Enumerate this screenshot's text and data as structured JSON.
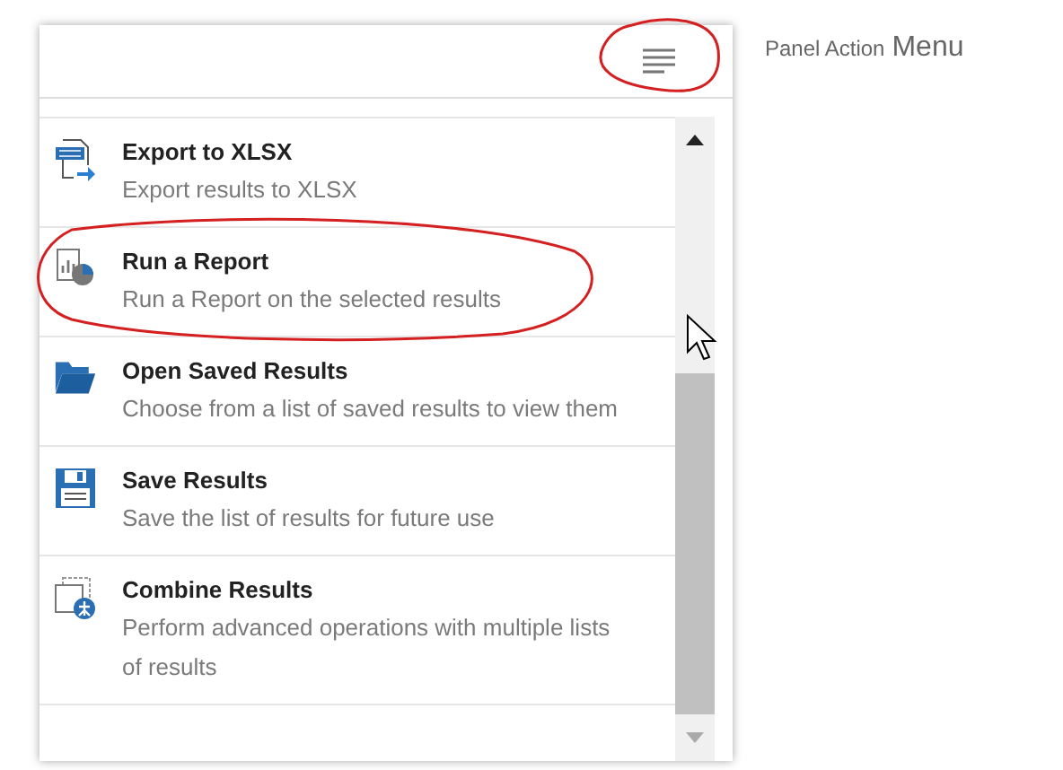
{
  "panel": {
    "menu_items": [
      {
        "kind": "xlsx",
        "title": "Export to XLSX",
        "description": "Export results to XLSX"
      },
      {
        "kind": "report",
        "title": "Run a Report",
        "description": "Run a Report on the selected results"
      },
      {
        "kind": "folder",
        "title": "Open Saved Results",
        "description": "Choose from a list of saved results to view them"
      },
      {
        "kind": "save",
        "title": "Save Results",
        "description": "Save the list of results for future use"
      },
      {
        "kind": "combine",
        "title": "Combine Results",
        "description": "Perform advanced operations with multiple lists of results"
      }
    ]
  },
  "caption": [
    "Panel Action",
    "Menu"
  ]
}
